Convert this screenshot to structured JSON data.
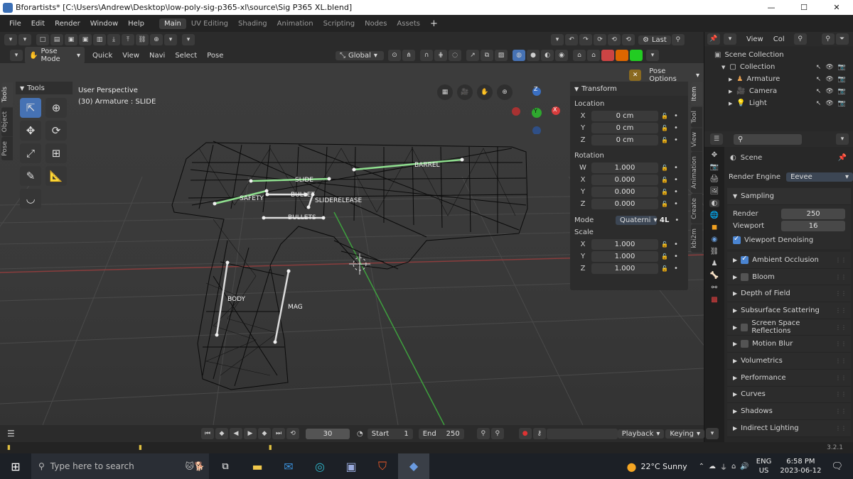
{
  "titlebar": {
    "title": "Bforartists* [C:\\Users\\Andrew\\Desktop\\low-poly-sig-p365-xl\\source\\Sig P365 XL.blend]",
    "minimize": "—",
    "maximize": "☐",
    "close": "✕"
  },
  "menus": [
    "File",
    "Edit",
    "Render",
    "Window",
    "Help"
  ],
  "workspaces": [
    "Main",
    "UV Editing",
    "Shading",
    "Animation",
    "Scripting",
    "Nodes",
    "Assets"
  ],
  "add_tab": "+",
  "topbar_right": {
    "last_label": "Last",
    "view_label": "View",
    "col_label": "Col"
  },
  "header": {
    "mode": "Pose Mode",
    "menus": [
      "Quick",
      "View",
      "Navi",
      "Select",
      "Pose"
    ],
    "orientation": "Global",
    "pose_options": "Pose Options"
  },
  "viewport": {
    "perspective": "User Perspective",
    "active": "(30) Armature : SLIDE",
    "axes": {
      "x": "X",
      "y": "Y",
      "z": "Z"
    }
  },
  "tools_panel": {
    "title": "Tools"
  },
  "left_tabs": [
    "Tools",
    "Object",
    "Pose"
  ],
  "bones": [
    "SLIDE",
    "BARREL",
    "SAFETY",
    "BULLET",
    "SLIDERELEASE",
    "BULLETS",
    "BODY",
    "MAG"
  ],
  "transform": {
    "title": "Transform",
    "location_label": "Location",
    "location": [
      {
        "axis": "X",
        "value": "0 cm"
      },
      {
        "axis": "Y",
        "value": "0 cm"
      },
      {
        "axis": "Z",
        "value": "0 cm"
      }
    ],
    "rotation_label": "Rotation",
    "rotation": [
      {
        "axis": "W",
        "value": "1.000"
      },
      {
        "axis": "X",
        "value": "0.000"
      },
      {
        "axis": "Y",
        "value": "0.000"
      },
      {
        "axis": "Z",
        "value": "0.000"
      }
    ],
    "mode_label": "Mode",
    "mode_value": "Quaterni",
    "mode_extra": "4L",
    "scale_label": "Scale",
    "scale": [
      {
        "axis": "X",
        "value": "1.000"
      },
      {
        "axis": "Y",
        "value": "1.000"
      },
      {
        "axis": "Z",
        "value": "1.000"
      }
    ]
  },
  "right_tabs": [
    "Item",
    "Tool",
    "View",
    "Animation",
    "Create",
    "kbi2m"
  ],
  "outliner": {
    "scene_collection": "Scene Collection",
    "items": [
      {
        "name": "Collection",
        "indent": 1,
        "icon": "collection-icon"
      },
      {
        "name": "Armature",
        "indent": 2,
        "icon": "armature-icon"
      },
      {
        "name": "Camera",
        "indent": 2,
        "icon": "camera-icon"
      },
      {
        "name": "Light",
        "indent": 2,
        "icon": "light-icon"
      }
    ]
  },
  "properties": {
    "scene": "Scene",
    "render_engine_label": "Render Engine",
    "render_engine": "Eevee",
    "sampling": "Sampling",
    "render_label": "Render",
    "render_value": "250",
    "viewport_label": "Viewport",
    "viewport_value": "16",
    "viewport_denoising": "Viewport Denoising",
    "panels": [
      {
        "label": "Ambient Occlusion",
        "check": "on"
      },
      {
        "label": "Bloom",
        "check": "off"
      },
      {
        "label": "Depth of Field",
        "check": "none"
      },
      {
        "label": "Subsurface Scattering",
        "check": "none"
      },
      {
        "label": "Screen Space Reflections",
        "check": "off"
      },
      {
        "label": "Motion Blur",
        "check": "off"
      },
      {
        "label": "Volumetrics",
        "check": "none"
      },
      {
        "label": "Performance",
        "check": "none"
      },
      {
        "label": "Curves",
        "check": "none"
      },
      {
        "label": "Shadows",
        "check": "none"
      },
      {
        "label": "Indirect Lighting",
        "check": "none"
      }
    ]
  },
  "timeline": {
    "frame": "30",
    "start_label": "Start",
    "start": "1",
    "end_label": "End",
    "end": "250",
    "playback": "Playback",
    "keying": "Keying"
  },
  "statusbar": {
    "version": "3.2.1"
  },
  "taskbar": {
    "search_placeholder": "Type here to search",
    "weather": "22°C  Sunny",
    "lang": "ENG",
    "region": "US",
    "time": "6:58 PM",
    "date": "2023-06-12"
  },
  "colors": {
    "accent": "#4672b4",
    "bone": "#8fe08f",
    "grid_red": "#9a3b3b",
    "grid_green": "#3f9a3f"
  }
}
